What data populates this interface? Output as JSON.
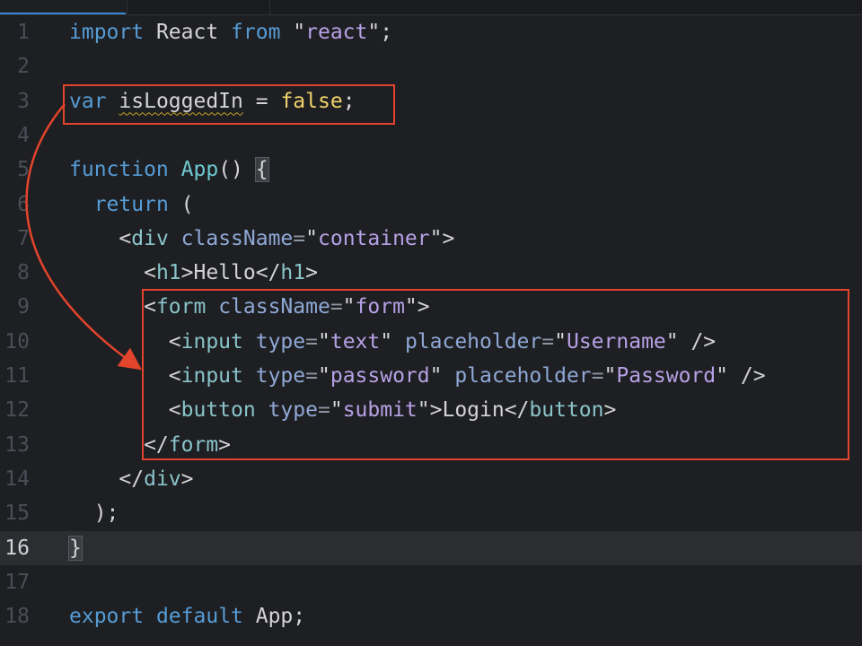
{
  "editor": {
    "language": "javascript",
    "current_line": 16,
    "lines": [
      {
        "n": "1",
        "tokens": [
          [
            "import",
            "k-blue"
          ],
          [
            " React ",
            "k-white"
          ],
          [
            "from",
            "k-blue"
          ],
          [
            " \"",
            "k-white"
          ],
          [
            "react",
            "k-strp"
          ],
          [
            "\";",
            "k-white"
          ]
        ]
      },
      {
        "n": "2",
        "tokens": []
      },
      {
        "n": "3",
        "tokens": [
          [
            "var",
            "k-blue"
          ],
          [
            " ",
            "k-white"
          ],
          [
            "isLoggedIn",
            "k-white squiggle"
          ],
          [
            " = ",
            "k-white"
          ],
          [
            "false",
            "k-yellow"
          ],
          [
            ";",
            "k-white"
          ]
        ]
      },
      {
        "n": "4",
        "tokens": []
      },
      {
        "n": "5",
        "tokens": [
          [
            "function",
            "k-blue"
          ],
          [
            " ",
            "k-white"
          ],
          [
            "App",
            "k-func"
          ],
          [
            "() ",
            "k-white"
          ],
          [
            "{",
            "k-white brace-box"
          ]
        ]
      },
      {
        "n": "6",
        "tokens": [
          [
            "  ",
            "k-white"
          ],
          [
            "return",
            "k-blue"
          ],
          [
            " (",
            "k-white"
          ]
        ]
      },
      {
        "n": "7",
        "tokens": [
          [
            "    <",
            "k-white"
          ],
          [
            "div",
            "k-teal"
          ],
          [
            " ",
            "k-white"
          ],
          [
            "className",
            "k-attr"
          ],
          [
            "=",
            "k-punct"
          ],
          [
            "\"",
            "k-white"
          ],
          [
            "container",
            "k-strp"
          ],
          [
            "\">",
            "k-white"
          ]
        ]
      },
      {
        "n": "8",
        "tokens": [
          [
            "      <",
            "k-white"
          ],
          [
            "h1",
            "k-teal"
          ],
          [
            ">Hello</",
            "k-white"
          ],
          [
            "h1",
            "k-teal"
          ],
          [
            ">",
            "k-white"
          ]
        ]
      },
      {
        "n": "9",
        "tokens": [
          [
            "      <",
            "k-white"
          ],
          [
            "form",
            "k-teal"
          ],
          [
            " ",
            "k-white"
          ],
          [
            "className",
            "k-attr"
          ],
          [
            "=",
            "k-punct"
          ],
          [
            "\"",
            "k-white"
          ],
          [
            "form",
            "k-strp"
          ],
          [
            "\">",
            "k-white"
          ]
        ]
      },
      {
        "n": "10",
        "tokens": [
          [
            "        <",
            "k-white"
          ],
          [
            "input",
            "k-teal"
          ],
          [
            " ",
            "k-white"
          ],
          [
            "type",
            "k-attr"
          ],
          [
            "=",
            "k-punct"
          ],
          [
            "\"",
            "k-white"
          ],
          [
            "text",
            "k-strp"
          ],
          [
            "\" ",
            "k-white"
          ],
          [
            "placeholder",
            "k-attr"
          ],
          [
            "=",
            "k-punct"
          ],
          [
            "\"",
            "k-white"
          ],
          [
            "Username",
            "k-strp"
          ],
          [
            "\" />",
            "k-white"
          ]
        ]
      },
      {
        "n": "11",
        "tokens": [
          [
            "        <",
            "k-white"
          ],
          [
            "input",
            "k-teal"
          ],
          [
            " ",
            "k-white"
          ],
          [
            "type",
            "k-attr"
          ],
          [
            "=",
            "k-punct"
          ],
          [
            "\"",
            "k-white"
          ],
          [
            "password",
            "k-strp"
          ],
          [
            "\" ",
            "k-white"
          ],
          [
            "placeholder",
            "k-attr"
          ],
          [
            "=",
            "k-punct"
          ],
          [
            "\"",
            "k-white"
          ],
          [
            "Password",
            "k-strp"
          ],
          [
            "\" />",
            "k-white"
          ]
        ]
      },
      {
        "n": "12",
        "tokens": [
          [
            "        <",
            "k-white"
          ],
          [
            "button",
            "k-teal"
          ],
          [
            " ",
            "k-white"
          ],
          [
            "type",
            "k-attr"
          ],
          [
            "=",
            "k-punct"
          ],
          [
            "\"",
            "k-white"
          ],
          [
            "submit",
            "k-strp"
          ],
          [
            "\">Login</",
            "k-white"
          ],
          [
            "button",
            "k-teal"
          ],
          [
            ">",
            "k-white"
          ]
        ]
      },
      {
        "n": "13",
        "tokens": [
          [
            "      </",
            "k-white"
          ],
          [
            "form",
            "k-teal"
          ],
          [
            ">",
            "k-white"
          ]
        ]
      },
      {
        "n": "14",
        "tokens": [
          [
            "    </",
            "k-white"
          ],
          [
            "div",
            "k-teal"
          ],
          [
            ">",
            "k-white"
          ]
        ]
      },
      {
        "n": "15",
        "tokens": [
          [
            "  );",
            "k-white"
          ]
        ]
      },
      {
        "n": "16",
        "tokens": [
          [
            "}",
            "k-white brace-box"
          ]
        ]
      },
      {
        "n": "17",
        "tokens": []
      },
      {
        "n": "18",
        "tokens": [
          [
            "export",
            "k-blue"
          ],
          [
            " ",
            "k-white"
          ],
          [
            "default",
            "k-blue"
          ],
          [
            " App;",
            "k-white"
          ]
        ]
      }
    ]
  },
  "annotations": {
    "color": "#e2442c",
    "highlight_lines": [
      [
        3,
        3
      ],
      [
        9,
        13
      ]
    ],
    "arrow": {
      "from_line": 3,
      "to_line": 11
    }
  }
}
